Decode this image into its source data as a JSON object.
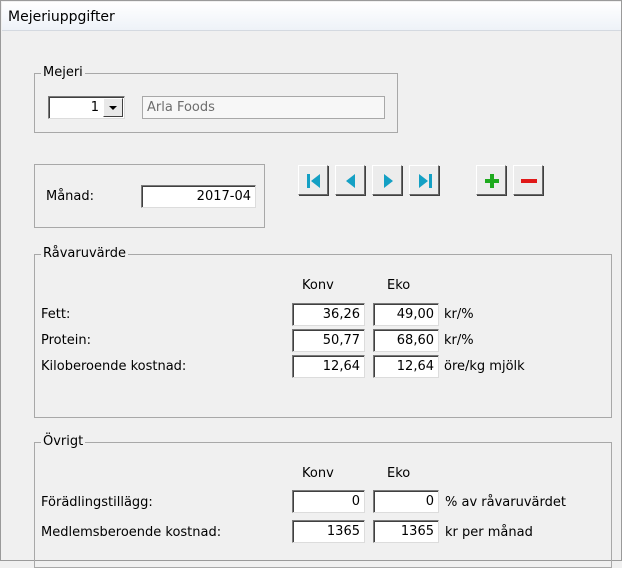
{
  "window": {
    "title": "Mejeriuppgifter"
  },
  "mejeri": {
    "legend": "Mejeri",
    "number": "1",
    "name": "Arla Foods"
  },
  "manad": {
    "label": "Månad:",
    "value": "2017-04"
  },
  "nav_icons": [
    "first-record-icon",
    "prev-record-icon",
    "next-record-icon",
    "last-record-icon",
    "add-record-icon",
    "delete-record-icon"
  ],
  "colors": {
    "nav_arrow": "#14a0c4",
    "add": "#1eaa1e",
    "delete": "#e01818"
  },
  "ravaruvarde": {
    "legend": "Råvaruvärde",
    "col_konv": "Konv",
    "col_eko": "Eko",
    "rows": [
      {
        "label": "Fett:",
        "konv": "36,26",
        "eko": "49,00",
        "unit": "kr/%"
      },
      {
        "label": "Protein:",
        "konv": "50,77",
        "eko": "68,60",
        "unit": "kr/%"
      },
      {
        "label": "Kiloberoende kostnad:",
        "konv": "12,64",
        "eko": "12,64",
        "unit": "öre/kg mjölk"
      }
    ]
  },
  "ovrigt": {
    "legend": "Övrigt",
    "col_konv": "Konv",
    "col_eko": "Eko",
    "rows": [
      {
        "label": "Förädlingstillägg:",
        "konv": "0",
        "eko": "0",
        "unit": "% av råvaruvärdet"
      },
      {
        "label": "Medlemsberoende kostnad:",
        "konv": "1365",
        "eko": "1365",
        "unit": "kr per månad"
      }
    ]
  }
}
